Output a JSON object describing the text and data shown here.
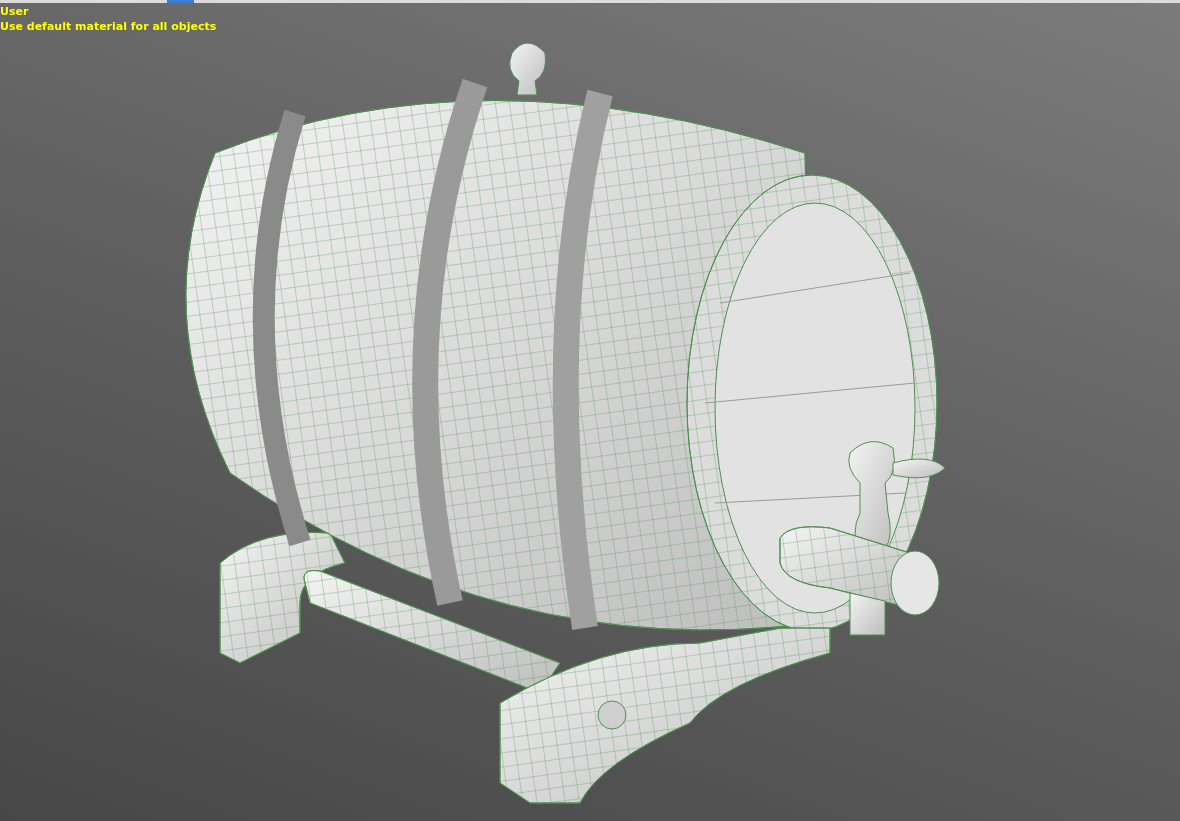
{
  "viewport": {
    "view_label": "User",
    "shading_label": "Use default material for all objects"
  }
}
